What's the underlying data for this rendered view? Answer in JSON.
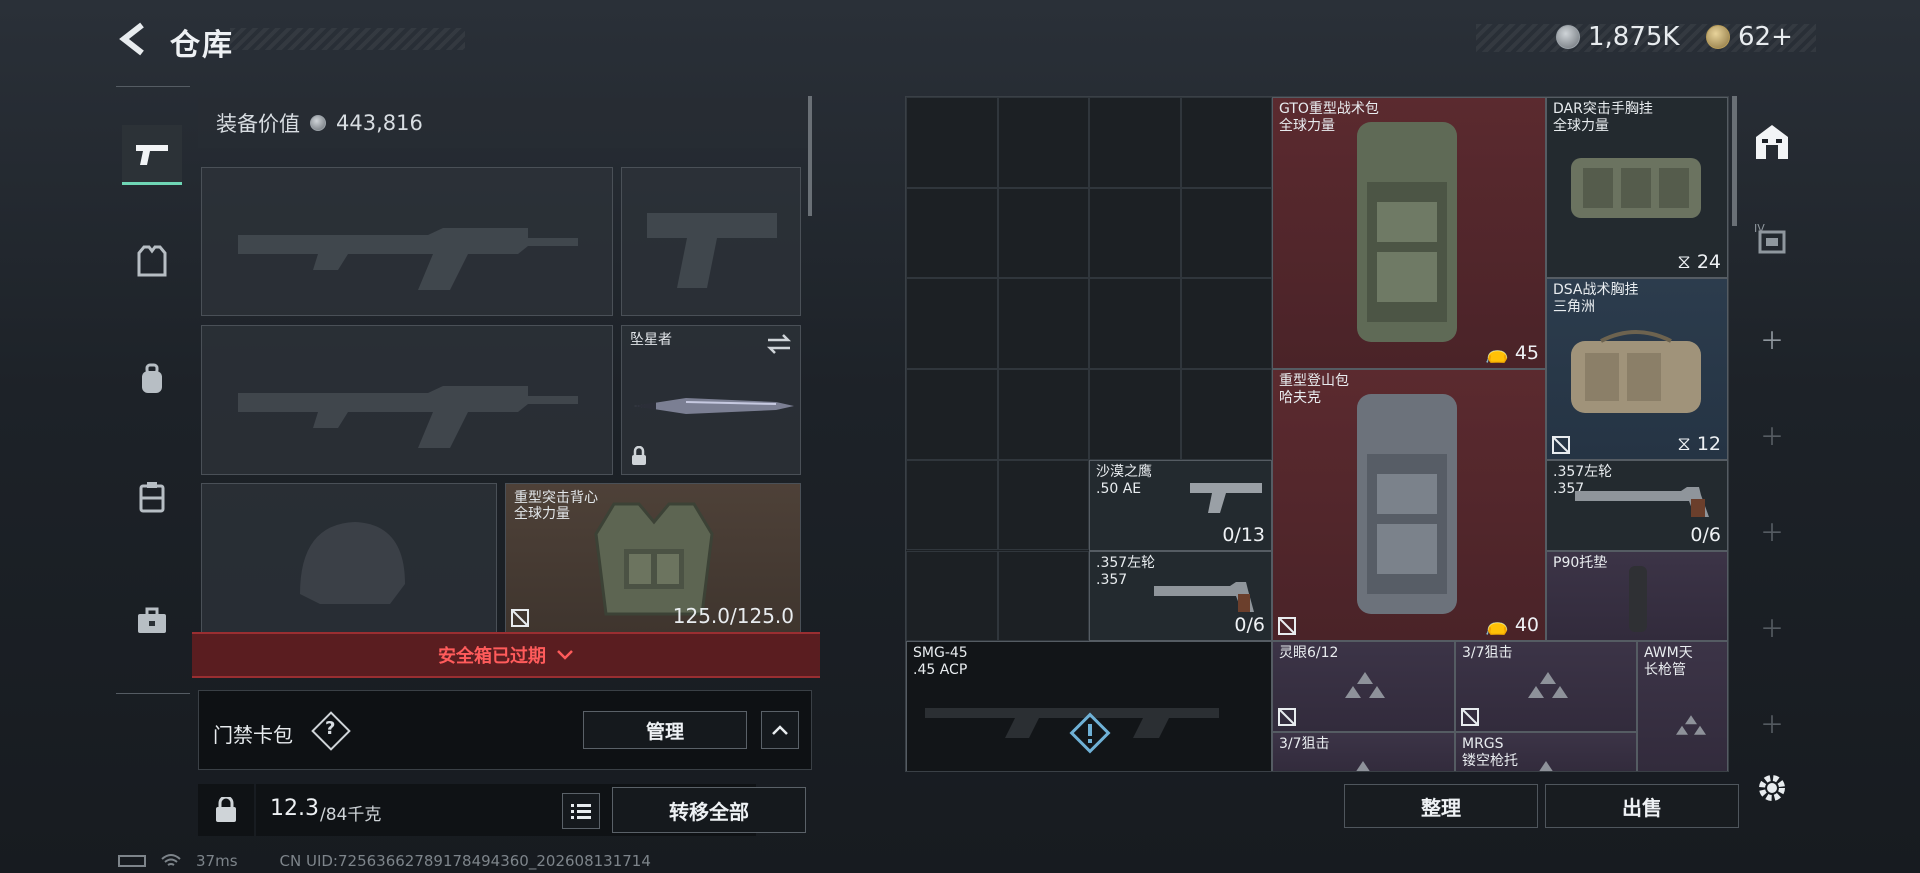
{
  "header": {
    "title": "仓库",
    "silver": "1,875K",
    "gold": "62+"
  },
  "equip": {
    "label": "装备价值",
    "value": "443,816"
  },
  "slots": {
    "melee_name": "坠星者",
    "armor_name": "重型突击背心",
    "armor_brand": "全球力量",
    "armor_durability": "125.0/125.0"
  },
  "safe_box": {
    "text": "安全箱已过期"
  },
  "keycard": {
    "label": "门禁卡包",
    "help": "?",
    "manage": "管理"
  },
  "weight": {
    "current": "12.3",
    "max": "/84千克",
    "transfer": "转移全部"
  },
  "grid": {
    "gto": {
      "name": "GTO重型战术包",
      "brand": "全球力量",
      "count": "45"
    },
    "dar": {
      "name": "DAR突击手胸挂",
      "brand": "全球力量",
      "count": "24"
    },
    "dsa": {
      "name": "DSA战术胸挂",
      "brand": "三角洲",
      "count": "12"
    },
    "mountain": {
      "name": "重型登山包",
      "brand": "哈夫克",
      "count": "40"
    },
    "eagle": {
      "name": "沙漠之鹰",
      "caliber": ".50 AE",
      "ammo": "0/13"
    },
    "rev1": {
      "name": ".357左轮",
      "caliber": ".357",
      "ammo": "0/6"
    },
    "rev2": {
      "name": ".357左轮",
      "caliber": ".357",
      "ammo": "0/6"
    },
    "p90": {
      "name": "P90托垫"
    },
    "smg": {
      "name": "SMG-45",
      "caliber": ".45 ACP"
    },
    "scope1": {
      "name": "灵眼6/12"
    },
    "scope2": {
      "name": "3/7狙击"
    },
    "awm": {
      "name": "AWM天",
      "sub": "长枪管"
    },
    "scope3": {
      "name": "3/7狙击"
    },
    "mrgs": {
      "name": "MRGS",
      "sub": "镂空枪托"
    }
  },
  "actions": {
    "sort": "整理",
    "sell": "出售"
  },
  "status": {
    "ping": "37ms",
    "uid": "CN UID:72563662789178494360_202608131714"
  }
}
